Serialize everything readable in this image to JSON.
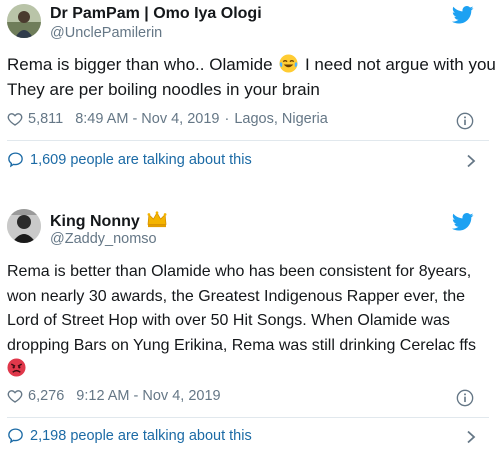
{
  "tweets": [
    {
      "name": "Dr PamPam | Omo Iya Ologi",
      "handle": "@UnclePamilerin",
      "avatar_icon": "avatar-photo",
      "lines": [
        "Rema is bigger than who.. Olamide ",
        " I need not argue with you.",
        "They are per boiling noodles in your brain"
      ],
      "emoji": "face-with-tears-of-joy",
      "likes": "5,811",
      "time": "8:49 AM - Nov 4, 2019",
      "location": "Lagos, Nigeria",
      "talking": "1,609 people are talking about this"
    },
    {
      "name": "King Nonny",
      "handle": "@Zaddy_nomso",
      "avatar_icon": "avatar-photo",
      "name_emoji": "crown",
      "lines": [
        "Rema is better than Olamide who has been consistent for 8years,",
        "won nearly 30 awards, the Greatest Indigenous Rapper ever, the",
        "Lord of Street Hop with over 50 Hit Songs. When Olamide was",
        "dropping Bars on Yung Erikina, Rema was still drinking Cerelac ffs"
      ],
      "end_emoji": "angry-face",
      "likes": "6,276",
      "time": "9:12 AM - Nov 4, 2019",
      "talking": "2,198 people are talking about this"
    }
  ],
  "colors": {
    "twitter_blue": "#1da1f2",
    "link_blue": "#1b6aa5",
    "muted_gray": "#657786",
    "text_dark": "#14171a",
    "divider": "#e1e8ed"
  }
}
